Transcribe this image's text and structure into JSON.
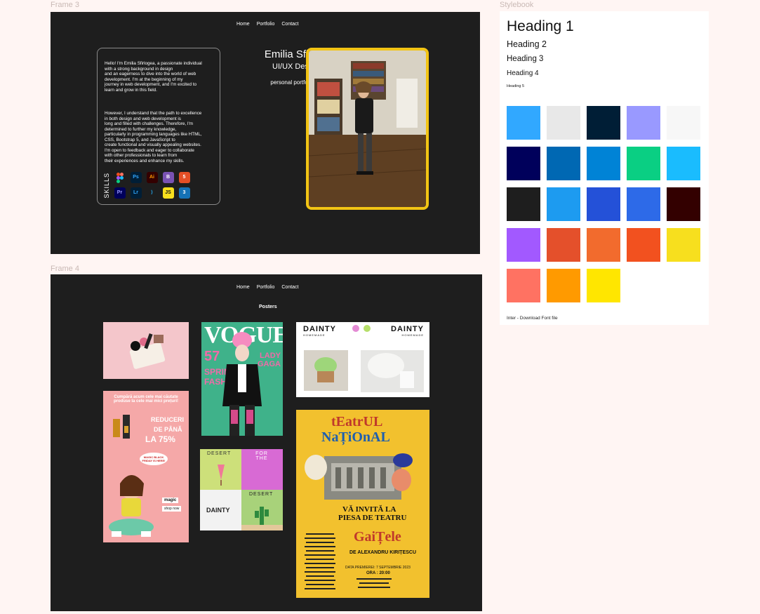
{
  "frames": {
    "frame3_label": "Frame 3",
    "frame4_label": "Frame 4",
    "stylebook_label": "Stylebook"
  },
  "nav": {
    "home": "Home",
    "portfolio": "Portfolio",
    "contact": "Contact"
  },
  "about": {
    "para1": "Hello! I'm Emilia Sfirlogea, a passionate individual\nwith a strong background in design\nand an eagerness to dive into the world of web\ndevelopment. I'm at the beginning of my\njourney in web development, and I'm excited to\nlearn and grow in this field.",
    "para2": "However, I understand that the path to excellence\nin both design and web development is\nlong and filled with challenges. Therefore, I'm\ndetermined to further my knowledge,\nparticularly in programming languages like HTML,\nCSS, Bootstrap 5, and JavaScript to\ncreate functional and visually appealing websites.\nI'm open to feedback and eager to collaborate\nwith other professionals to learn from\ntheir experiences and enhance my skills.",
    "skills_label": "SKILLS",
    "skills": [
      {
        "icon": "figma-icon",
        "text": "",
        "bg": "#1e1e1e",
        "fg": "#f24e1e"
      },
      {
        "icon": "photoshop-icon",
        "text": "Ps",
        "bg": "#001e36",
        "fg": "#31a8ff"
      },
      {
        "icon": "illustrator-icon",
        "text": "Ai",
        "bg": "#330000",
        "fg": "#ff9a00"
      },
      {
        "icon": "bootstrap-icon",
        "text": "B",
        "bg": "#7952b3",
        "fg": "#ffffff"
      },
      {
        "icon": "html5-icon",
        "text": "5",
        "bg": "#e34f26",
        "fg": "#ffffff"
      },
      {
        "icon": "premiere-icon",
        "text": "Pr",
        "bg": "#00005b",
        "fg": "#9999ff"
      },
      {
        "icon": "lightroom-icon",
        "text": "Lr",
        "bg": "#001e36",
        "fg": "#31a8ff"
      },
      {
        "icon": "vscode-icon",
        "text": "⟩",
        "bg": "#1e1e1e",
        "fg": "#23a9f2"
      },
      {
        "icon": "javascript-icon",
        "text": "JS",
        "bg": "#f7df1e",
        "fg": "#111111"
      },
      {
        "icon": "css3-icon",
        "text": "3",
        "bg": "#1572b6",
        "fg": "#ffffff"
      }
    ]
  },
  "hero": {
    "name": "Emilia Sfirlogea",
    "role": "UI/UX Dessigner",
    "desc": "personal portfolio design"
  },
  "posters_section": {
    "title": "Posters"
  },
  "posters": {
    "vogue_title": "VOGUE",
    "vogue_number": "57",
    "vogue_lines": [
      "SPRING",
      "FASHION"
    ],
    "vogue_side": "LADY GAGA",
    "promo_text": "Cumpără acum cele mai căutate produse la cele mai mici prețuri!",
    "promo_discount_1": "REDUCERI",
    "promo_discount_2": "DE PÂNĂ",
    "promo_discount_3": "LA 75%",
    "promo_bubble": "MAGIC BLACK FRIDAY IS HERE!",
    "promo_brand": "magic",
    "promo_shop": "shop now",
    "dainty_left": "DAINTY",
    "dainty_right": "DAINTY",
    "dainty_sub": "HOMEMADE",
    "desert_1": "DESERT",
    "desert_2": "FOR THE",
    "desert_3": "DESERT",
    "desert_brand": "DAINTY",
    "teatrul_1": "tEatrUL",
    "teatrul_2": "NaȚiOnAL",
    "teatrul_invite_1": "VĂ INVITĂ LA",
    "teatrul_invite_2": "PIESA DE TEATRU",
    "teatrul_play": "GaiȚele",
    "teatrul_author": "DE ALEXANDRU KIRIȚESCU",
    "teatrul_date": "DATA PREMIEREI: 7 SEPTEMBRIE 2023",
    "teatrul_hour": "ORA : 20:00"
  },
  "stylebook": {
    "h1": "Heading 1",
    "h2": "Heading 2",
    "h3": "Heading 3",
    "h4": "Heading 4",
    "h5": "Heading 5",
    "font": "Inter - Download Font file",
    "colors": [
      "#31a8ff",
      "#e8e8e8",
      "#001e36",
      "#9999ff",
      "#f7f7f7",
      "#00005b",
      "#0068b3",
      "#0083d6",
      "#0acf83",
      "#1abcfe",
      "#1e1e1e",
      "#1d9bf0",
      "#2451d8",
      "#2d6ae8",
      "#330000",
      "#a259ff",
      "#e4502b",
      "#f26b2d",
      "#f2511f",
      "#f7df1e",
      "#ff7262",
      "#ff9a00",
      "#ffe600"
    ]
  }
}
